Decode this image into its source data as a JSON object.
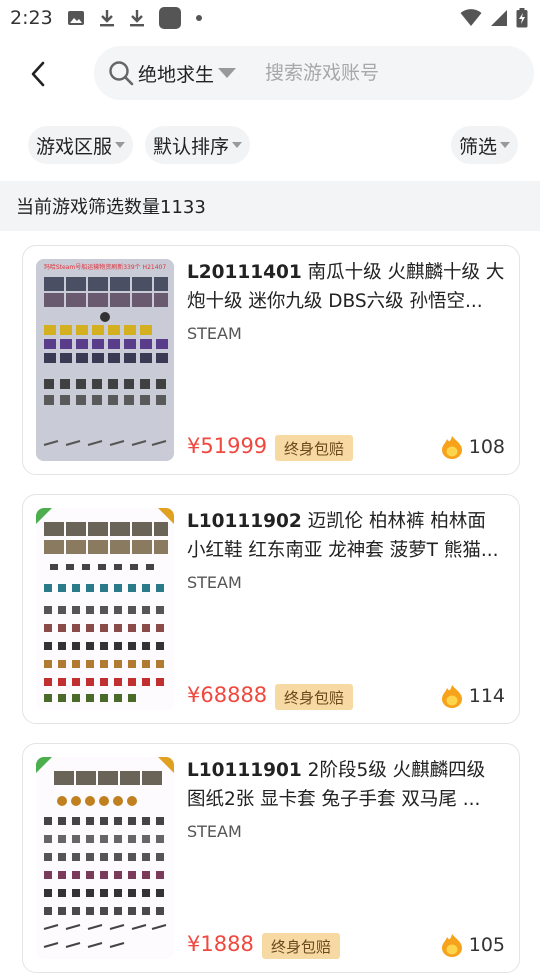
{
  "status_bar": {
    "time": "2:23",
    "icons": [
      "image-icon",
      "download-icon",
      "download-icon",
      "app-icon",
      "dot-icon",
      "wifi-icon",
      "signal-icon",
      "battery-icon"
    ]
  },
  "header": {
    "game_select": "绝地求生",
    "search_placeholder": "搜索游戏账号"
  },
  "filters": {
    "server": "游戏区服",
    "sort": "默认排序",
    "filter": "筛选"
  },
  "count_text": "当前游戏筛选数量1133",
  "listings": [
    {
      "id": "L20111401",
      "desc": "南瓜十级 火麒麟十级 大炮十级 迷你九级 DBS六级 孙悟空...",
      "platform": "STEAM",
      "price": "¥51999",
      "badge": "终身包赔",
      "hot": "108",
      "thumb_header": "玛哈Steam号船运输物资刷新339个 H21407"
    },
    {
      "id": "L10111902",
      "desc": "迈凯伦 柏林裤 柏林面 小红鞋 红东南亚 龙神套 菠萝T 熊猫...",
      "platform": "STEAM",
      "price": "¥68888",
      "badge": "终身包赔",
      "hot": "114",
      "thumb_header": ""
    },
    {
      "id": "L10111901",
      "desc": "2阶段5级 火麒麟四级 图纸2张 显卡套 兔子手套 双马尾 ...",
      "platform": "STEAM",
      "price": "¥1888",
      "badge": "终身包赔",
      "hot": "105",
      "thumb_header": ""
    }
  ],
  "colors": {
    "price": "#f0483e",
    "badge_bg": "#f7d9a3",
    "badge_text": "#6a4a1c",
    "hot": "#f7a21b"
  }
}
